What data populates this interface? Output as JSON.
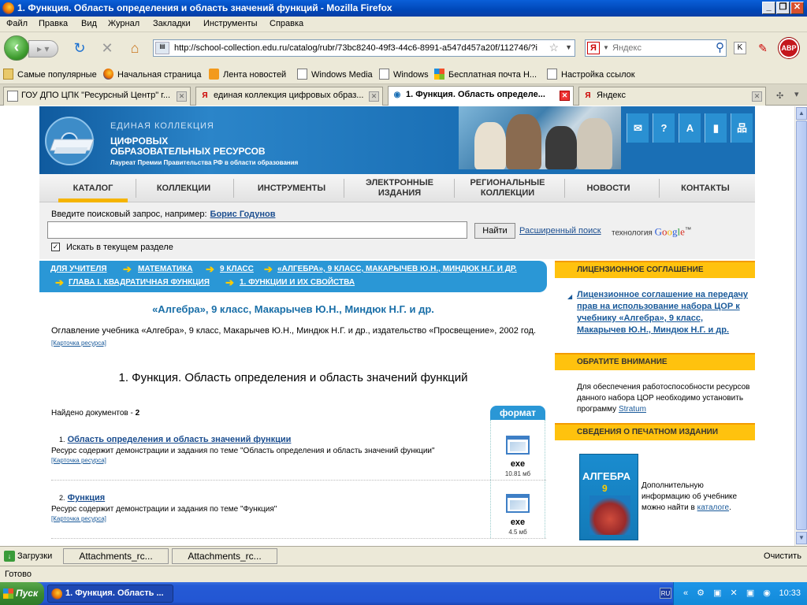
{
  "window": {
    "title": "1. Функция. Область определения и область значений функций - Mozilla Firefox"
  },
  "menu": [
    "Файл",
    "Правка",
    "Вид",
    "Журнал",
    "Закладки",
    "Инструменты",
    "Справка"
  ],
  "nav": {
    "url": "http://school-collection.edu.ru/catalog/rubr/73bc8240-49f3-44c6-8991-a547d457a20f/112746/?i",
    "search_placeholder": "Яндекс",
    "yandex_letter": "Я",
    "abp_label": "ABP"
  },
  "bookmarks": [
    "Самые популярные",
    "Начальная страница",
    "Лента новостей",
    "Windows Media",
    "Windows",
    "Бесплатная почта Н...",
    "Настройка ссылок"
  ],
  "tabs": [
    {
      "label": "ГОУ ДПО ЦПК \"Ресурсный Центр\" г...",
      "active": false
    },
    {
      "label": "единая коллекция цифровых образ...",
      "active": false
    },
    {
      "label": "1. Функция. Область определе...",
      "active": true
    },
    {
      "label": "Яндекс",
      "active": false
    }
  ],
  "banner": {
    "line1": "ЕДИНАЯ КОЛЛЕКЦИЯ",
    "line2a": "ЦИФРОВЫХ",
    "line2b": "ОБРАЗОВАТЕЛЬНЫХ РЕСУРСОВ",
    "line3": "Лауреат Премии Правительства РФ в области образования",
    "icons": [
      "✉",
      "?",
      "A",
      "▮",
      "品"
    ]
  },
  "mainnav": [
    {
      "label": "КАТАЛОГ",
      "line2": ""
    },
    {
      "label": "КОЛЛЕКЦИИ",
      "line2": ""
    },
    {
      "label": "ИНСТРУМЕНТЫ",
      "line2": ""
    },
    {
      "label": "ЭЛЕКТРОННЫЕ",
      "line2": "ИЗДАНИЯ"
    },
    {
      "label": "РЕГИОНАЛЬНЫЕ",
      "line2": "КОЛЛЕКЦИИ"
    },
    {
      "label": "НОВОСТИ",
      "line2": ""
    },
    {
      "label": "КОНТАКТЫ",
      "line2": ""
    }
  ],
  "search": {
    "hint": "Введите поисковый запрос, например:",
    "example": "Борис Годунов",
    "find_button": "Найти",
    "advanced": "Расширенный поиск",
    "tech": "технология",
    "google": "Google",
    "tm": "™",
    "checkbox_label": "Искать в текущем разделе",
    "checked": "✓"
  },
  "breadcrumb": [
    "ДЛЯ УЧИТЕЛЯ",
    "МАТЕМАТИКА",
    "9 КЛАСС",
    "«АЛГЕБРА», 9 КЛАСС, МАКАРЫЧЕВ Ю.Н., МИНДЮК Н.Г. И ДР.",
    "ГЛАВА I. КВАДРАТИЧНАЯ ФУНКЦИЯ",
    "1. ФУНКЦИИ И ИХ СВОЙСТВА"
  ],
  "arrow": "➔",
  "main": {
    "book_title": "«Алгебра», 9 класс, Макарычев Ю.Н., Миндюк Н.Г. и др.",
    "book_desc": "Оглавление учебника «Алгебра», 9 класс, Макарычев Ю.Н., Миндюк Н.Г. и др., издательство «Просвещение», 2002 год.",
    "card_link": "[Карточка ресурса]",
    "section_title": "1. Функция. Область определения и область значений функций",
    "found_label": "Найдено документов",
    "found_sep": " - ",
    "found_count": "2",
    "format_head": "формат"
  },
  "documents": [
    {
      "num": "1.",
      "title": "Область определения и область значений функции",
      "desc": "Ресурс содержит демонстрации и задания по теме \"Область определения и область значений функции\"",
      "card": "[Карточка ресурса]",
      "ext": "exe",
      "size": "10.81 мб"
    },
    {
      "num": "2.",
      "title": "Функция",
      "desc": "Ресурс содержит демонстрации и задания по теме \"Функция\"",
      "card": "[Карточка ресурса]",
      "ext": "exe",
      "size": "4.5 мб"
    }
  ],
  "sidebar": {
    "license_head": "ЛИЦЕНЗИОННОЕ СОГЛАШЕНИЕ",
    "license_link": "Лицензионное соглашение на передачу прав на использование набора ЦОР к учебнику «Алгебра», 9 класс, Макарычев Ю.Н., Миндюк Н.Г. и др.",
    "attention_head": "ОБРАТИТЕ ВНИМАНИЕ",
    "attention_text": "Для обеспечения работоспособности ресурсов данного набора ЦОР необходимо установить программу",
    "stratum": "Stratum",
    "print_head": "СВЕДЕНИЯ О ПЕЧАТНОМ ИЗДАНИИ",
    "print_text": "Дополнительную информацию об учебнике можно найти в",
    "catalog_link": "каталоге",
    "cover_title": "АЛГЕБРА",
    "cover_grade": "9"
  },
  "downloads": {
    "label": "Загрузки",
    "items": [
      "Attachments_rc...",
      "Attachments_rc..."
    ],
    "clear": "Очистить"
  },
  "status": "Готово",
  "taskbar": {
    "start": "Пуск",
    "item": "1. Функция. Область ...",
    "lang": "RU",
    "time": "10:33",
    "tray": "« ⚙ ▣ ✕ ▣ ◉"
  }
}
